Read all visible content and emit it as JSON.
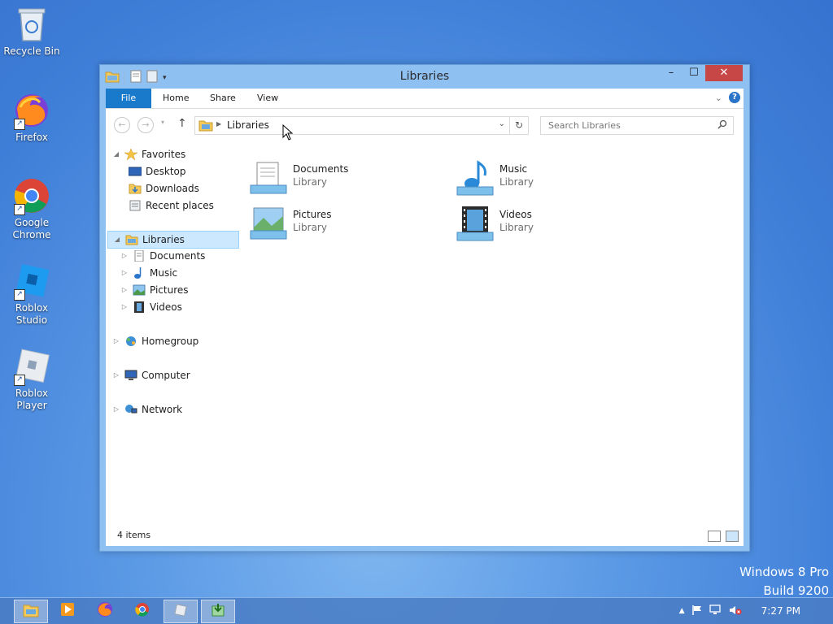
{
  "desktop": {
    "icons": [
      {
        "label": "Recycle Bin",
        "icon": "recycle-bin-icon"
      },
      {
        "label": "Firefox",
        "icon": "firefox-icon"
      },
      {
        "label": "Google Chrome",
        "icon": "chrome-icon"
      },
      {
        "label": "Roblox Studio",
        "icon": "roblox-studio-icon"
      },
      {
        "label": "Roblox Player",
        "icon": "roblox-player-icon"
      }
    ]
  },
  "window": {
    "title": "Libraries",
    "buttons": {
      "minimize": "–",
      "maximize": "☐",
      "close": "✕"
    },
    "ribbon": {
      "tabs": [
        "File",
        "Home",
        "Share",
        "View"
      ],
      "help_label": "?"
    },
    "address": {
      "path": "Libraries"
    },
    "search": {
      "placeholder": "Search Libraries"
    },
    "navpane": {
      "favorites": {
        "label": "Favorites",
        "items": [
          "Desktop",
          "Downloads",
          "Recent places"
        ]
      },
      "libraries": {
        "label": "Libraries",
        "items": [
          "Documents",
          "Music",
          "Pictures",
          "Videos"
        ]
      },
      "homegroup": "Homegroup",
      "computer": "Computer",
      "network": "Network"
    },
    "libraries": [
      {
        "name": "Documents",
        "type": "Library",
        "icon": "documents-library-icon"
      },
      {
        "name": "Music",
        "type": "Library",
        "icon": "music-library-icon"
      },
      {
        "name": "Pictures",
        "type": "Library",
        "icon": "pictures-library-icon"
      },
      {
        "name": "Videos",
        "type": "Library",
        "icon": "videos-library-icon"
      }
    ],
    "status": {
      "count": "4 items"
    }
  },
  "watermark": {
    "line1": "Windows 8 Pro",
    "line2": "Build 9200"
  },
  "taskbar": {
    "apps": [
      "file-explorer",
      "media-player",
      "firefox",
      "chrome",
      "roblox",
      "uninstall-tool"
    ],
    "clock": "7:27 PM"
  },
  "colors": {
    "accent": "#1979ca",
    "selection": "#cce8ff",
    "close": "#c74646"
  }
}
